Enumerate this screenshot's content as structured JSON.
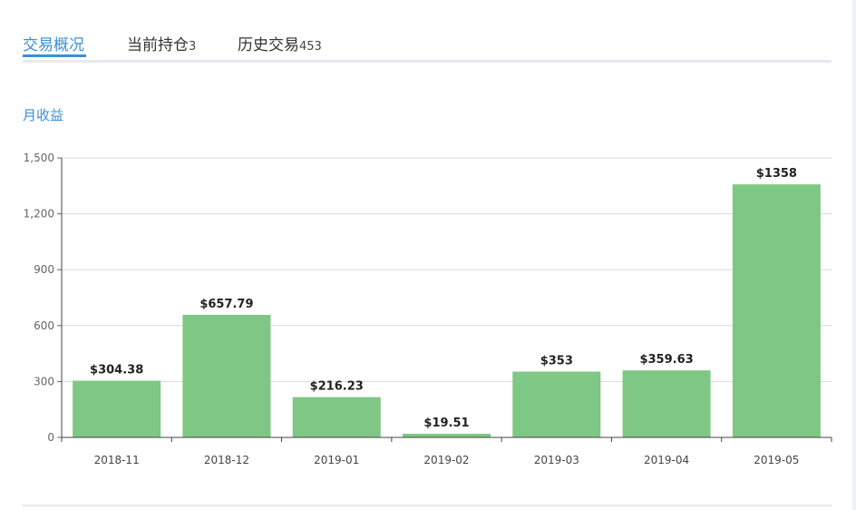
{
  "tabs": [
    {
      "label": "交易概况",
      "count": ""
    },
    {
      "label": "当前持仓",
      "count": "3"
    },
    {
      "label": "历史交易",
      "count": "453"
    }
  ],
  "section_title": "月收益",
  "colors": {
    "accent": "#3a8fd6",
    "bar": "#7fc784"
  },
  "chart_data": {
    "type": "bar",
    "categories": [
      "2018-11",
      "2018-12",
      "2019-01",
      "2019-02",
      "2019-03",
      "2019-04",
      "2019-05"
    ],
    "values": [
      304.38,
      657.79,
      216.23,
      19.51,
      353,
      359.63,
      1358
    ],
    "data_labels": [
      "$304.38",
      "$657.79",
      "$216.23",
      "$19.51",
      "$353",
      "$359.63",
      "$1358"
    ],
    "ylim": [
      0,
      1500
    ],
    "yticks": [
      0,
      300,
      600,
      900,
      1200,
      1500
    ],
    "ytick_labels": [
      "0",
      "300",
      "600",
      "900",
      "1,200",
      "1,500"
    ],
    "grid": true,
    "title": "",
    "xlabel": "",
    "ylabel": ""
  }
}
